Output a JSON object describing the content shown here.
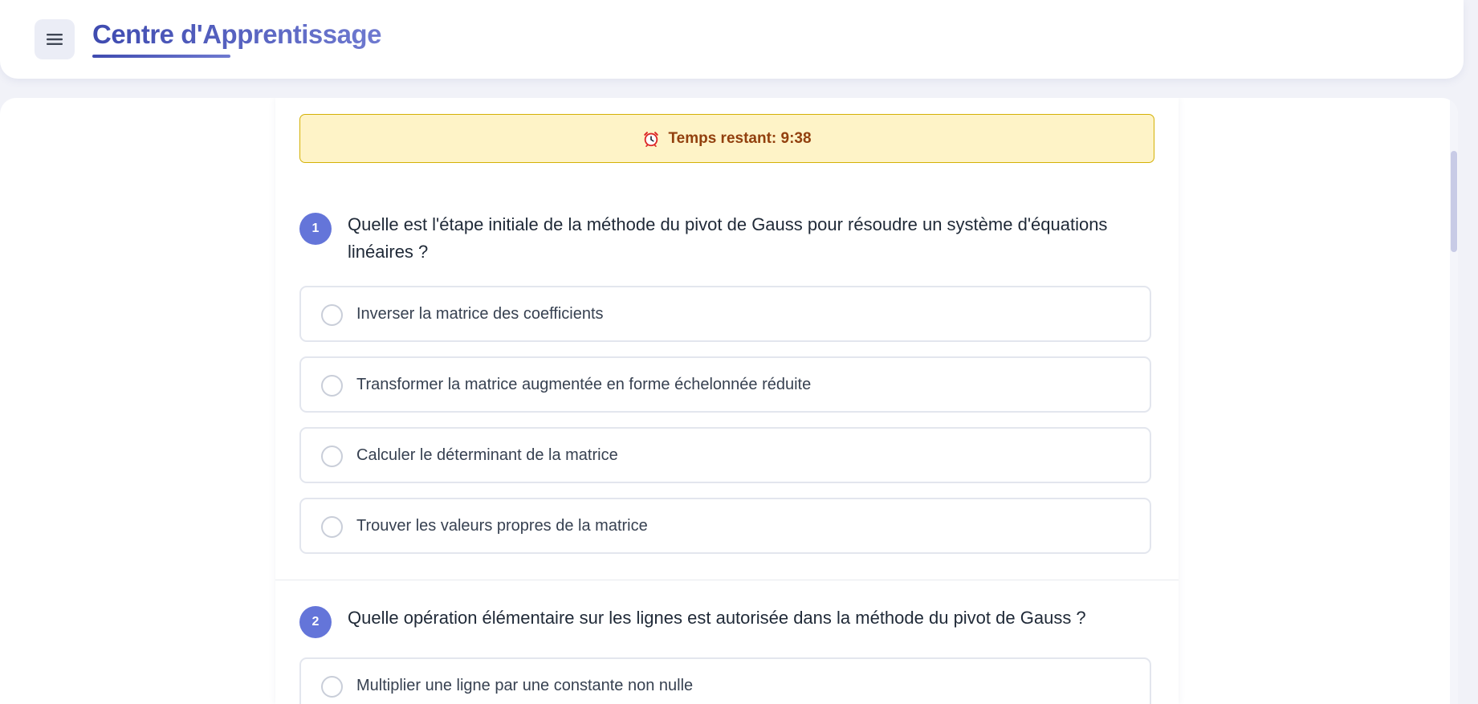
{
  "header": {
    "menu_icon": "hamburger-menu-icon",
    "title": "Centre d'Apprentissage"
  },
  "timer": {
    "icon": "alarm-clock-icon",
    "text": "Temps restant: 9:38"
  },
  "questions": [
    {
      "number": "1",
      "text": "Quelle est l'étape initiale de la méthode du pivot de Gauss pour résoudre un système d'équations linéaires ?",
      "options": [
        {
          "label": "Inverser la matrice des coefficients"
        },
        {
          "label": "Transformer la matrice augmentée en forme échelonnée réduite"
        },
        {
          "label": "Calculer le déterminant de la matrice"
        },
        {
          "label": "Trouver les valeurs propres de la matrice"
        }
      ]
    },
    {
      "number": "2",
      "text": "Quelle opération élémentaire sur les lignes est autorisée dans la méthode du pivot de Gauss ?",
      "options": [
        {
          "label": "Multiplier une ligne par une constante non nulle"
        }
      ]
    }
  ],
  "colors": {
    "accent": "#6475d9",
    "title": "#4f5bb8",
    "timer_bg": "#fef3c7",
    "timer_border": "#d4b106",
    "timer_text": "#92400e"
  }
}
